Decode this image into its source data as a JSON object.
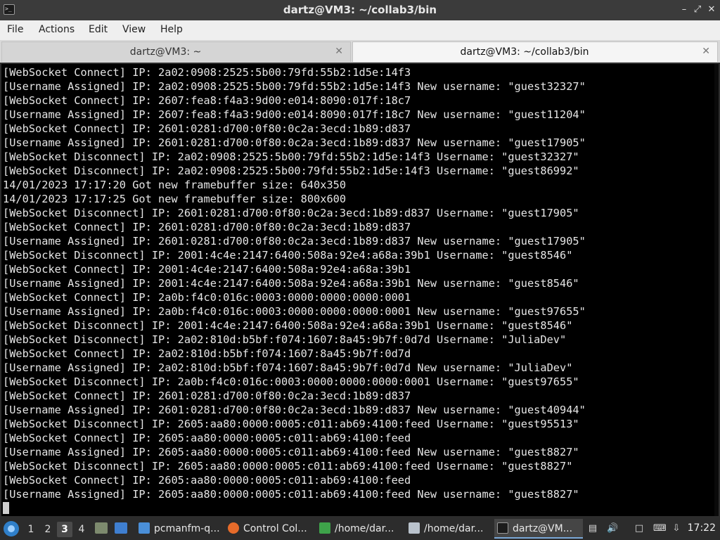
{
  "window": {
    "title": "dartz@VM3: ~/collab3/bin",
    "controls": {
      "minimize": "–",
      "maximize": "⤢",
      "close": "✕"
    }
  },
  "menubar": {
    "items": [
      "File",
      "Actions",
      "Edit",
      "View",
      "Help"
    ]
  },
  "tabs": [
    {
      "label": "dartz@VM3: ~",
      "close": "✕"
    },
    {
      "label": "dartz@VM3: ~/collab3/bin",
      "close": "✕"
    }
  ],
  "terminal": {
    "lines": [
      "[WebSocket Connect] IP: 2a02:0908:2525:5b00:79fd:55b2:1d5e:14f3",
      "[Username Assigned] IP: 2a02:0908:2525:5b00:79fd:55b2:1d5e:14f3 New username: \"guest32327\"",
      "[WebSocket Connect] IP: 2607:fea8:f4a3:9d00:e014:8090:017f:18c7",
      "[Username Assigned] IP: 2607:fea8:f4a3:9d00:e014:8090:017f:18c7 New username: \"guest11204\"",
      "[WebSocket Connect] IP: 2601:0281:d700:0f80:0c2a:3ecd:1b89:d837",
      "[Username Assigned] IP: 2601:0281:d700:0f80:0c2a:3ecd:1b89:d837 New username: \"guest17905\"",
      "[WebSocket Disconnect] IP: 2a02:0908:2525:5b00:79fd:55b2:1d5e:14f3 Username: \"guest32327\"",
      "[WebSocket Disconnect] IP: 2a02:0908:2525:5b00:79fd:55b2:1d5e:14f3 Username: \"guest86992\"",
      "14/01/2023 17:17:20 Got new framebuffer size: 640x350",
      "14/01/2023 17:17:25 Got new framebuffer size: 800x600",
      "[WebSocket Disconnect] IP: 2601:0281:d700:0f80:0c2a:3ecd:1b89:d837 Username: \"guest17905\"",
      "[WebSocket Connect] IP: 2601:0281:d700:0f80:0c2a:3ecd:1b89:d837",
      "[Username Assigned] IP: 2601:0281:d700:0f80:0c2a:3ecd:1b89:d837 New username: \"guest17905\"",
      "[WebSocket Disconnect] IP: 2001:4c4e:2147:6400:508a:92e4:a68a:39b1 Username: \"guest8546\"",
      "[WebSocket Connect] IP: 2001:4c4e:2147:6400:508a:92e4:a68a:39b1",
      "[Username Assigned] IP: 2001:4c4e:2147:6400:508a:92e4:a68a:39b1 New username: \"guest8546\"",
      "[WebSocket Connect] IP: 2a0b:f4c0:016c:0003:0000:0000:0000:0001",
      "[Username Assigned] IP: 2a0b:f4c0:016c:0003:0000:0000:0000:0001 New username: \"guest97655\"",
      "[WebSocket Disconnect] IP: 2001:4c4e:2147:6400:508a:92e4:a68a:39b1 Username: \"guest8546\"",
      "[WebSocket Disconnect] IP: 2a02:810d:b5bf:f074:1607:8a45:9b7f:0d7d Username: \"JuliaDev\"",
      "[WebSocket Connect] IP: 2a02:810d:b5bf:f074:1607:8a45:9b7f:0d7d",
      "[Username Assigned] IP: 2a02:810d:b5bf:f074:1607:8a45:9b7f:0d7d New username: \"JuliaDev\"",
      "[WebSocket Disconnect] IP: 2a0b:f4c0:016c:0003:0000:0000:0000:0001 Username: \"guest97655\"",
      "[WebSocket Connect] IP: 2601:0281:d700:0f80:0c2a:3ecd:1b89:d837",
      "[Username Assigned] IP: 2601:0281:d700:0f80:0c2a:3ecd:1b89:d837 New username: \"guest40944\"",
      "[WebSocket Disconnect] IP: 2605:aa80:0000:0005:c011:ab69:4100:feed Username: \"guest95513\"",
      "[WebSocket Connect] IP: 2605:aa80:0000:0005:c011:ab69:4100:feed",
      "[Username Assigned] IP: 2605:aa80:0000:0005:c011:ab69:4100:feed New username: \"guest8827\"",
      "[WebSocket Disconnect] IP: 2605:aa80:0000:0005:c011:ab69:4100:feed Username: \"guest8827\"",
      "[WebSocket Connect] IP: 2605:aa80:0000:0005:c011:ab69:4100:feed",
      "[Username Assigned] IP: 2605:aa80:0000:0005:c011:ab69:4100:feed New username: \"guest8827\""
    ]
  },
  "taskbar": {
    "workspaces": [
      "1",
      "2",
      "3",
      "4"
    ],
    "active_workspace": "3",
    "tasks": [
      {
        "label": "pcmanfm-q...",
        "icon": "folder-icon"
      },
      {
        "label": "Control Col...",
        "icon": "firefox-icon"
      },
      {
        "label": "/home/dar...",
        "icon": "text-editor-icon"
      },
      {
        "label": "/home/dar...",
        "icon": "featherpad-icon"
      },
      {
        "label": "dartz@VM...",
        "icon": "terminal-icon"
      }
    ],
    "clock": "17:22"
  },
  "colors": {
    "terminal_bg": "#000000",
    "terminal_fg": "#e6e6e6",
    "titlebar_bg": "#3b3b3b",
    "taskbar_bg": "#2c2c2c"
  }
}
